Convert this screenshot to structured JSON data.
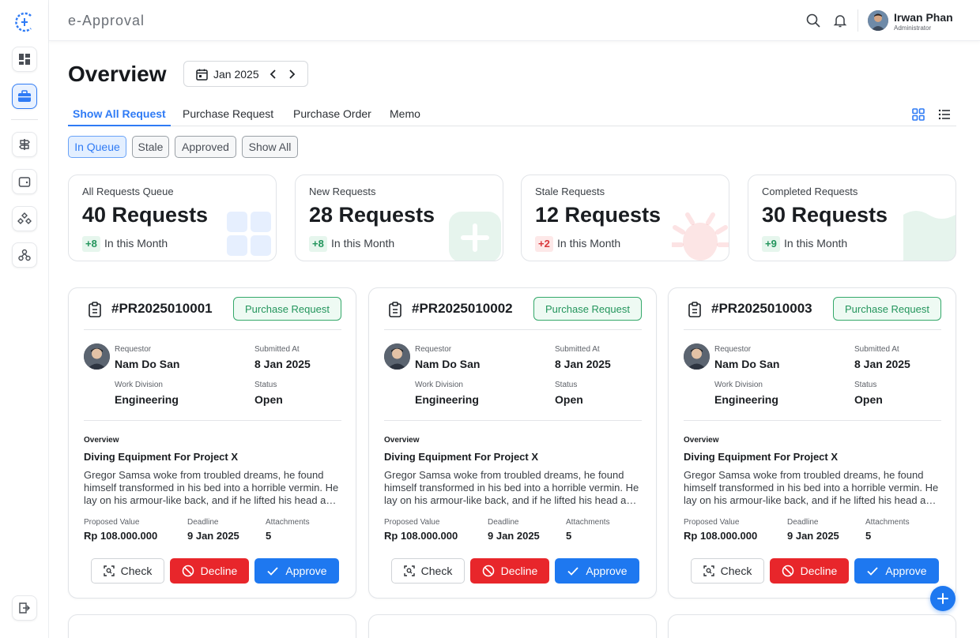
{
  "app": {
    "title": "e-Approval"
  },
  "user": {
    "name": "Irwan Phan",
    "role": "Administrator"
  },
  "header": {
    "title": "Overview",
    "date": "Jan 2025"
  },
  "tabs": [
    "Show All Request",
    "Purchase Request",
    "Purchase Order",
    "Memo"
  ],
  "filters": [
    "In Queue",
    "Stale",
    "Approved",
    "Show All"
  ],
  "stats": [
    {
      "label": "All Requests Queue",
      "value": "40 Requests",
      "delta": "+8",
      "note": "In this Month",
      "color": "#2f7bf5"
    },
    {
      "label": "New Requests",
      "value": "28 Requests",
      "delta": "+8",
      "note": "In this Month",
      "color": "#34a86a"
    },
    {
      "label": "Stale Requests",
      "value": "12 Requests",
      "delta": "+2",
      "note": "In this Month",
      "color": "#e8262b"
    },
    {
      "label": "Completed Requests",
      "value": "30 Requests",
      "delta": "+9",
      "note": "In this Month",
      "color": "#34a86a"
    }
  ],
  "labels": {
    "requestor": "Requestor",
    "submitted_at": "Submitted At",
    "work_division": "Work Division",
    "status": "Status",
    "overview": "Overview",
    "proposed_value": "Proposed Value",
    "deadline": "Deadline",
    "attachments": "Attachments",
    "check": "Check",
    "decline": "Decline",
    "approve": "Approve"
  },
  "requests": [
    {
      "id": "#PR2025010001",
      "type": "Purchase Request",
      "requestor": "Nam Do San",
      "submitted": "8 Jan 2025",
      "division": "Engineering",
      "status": "Open",
      "title": "Diving Equipment For Project X",
      "description": "Gregor Samsa woke from troubled dreams, he found himself transformed in  his bed into a horrible vermin. He lay on his armour-like back, and if he lifted his head a little he could see his brown belly.",
      "value": "Rp 108.000.000",
      "deadline": "9 Jan 2025",
      "attachments": "5"
    },
    {
      "id": "#PR2025010002",
      "type": "Purchase Request",
      "requestor": "Nam Do San",
      "submitted": "8 Jan 2025",
      "division": "Engineering",
      "status": "Open",
      "title": "Diving Equipment For Project X",
      "description": "Gregor Samsa woke from troubled dreams, he found himself transformed in  his bed into a horrible vermin. He lay on his armour-like back, and if he lifted his head a little he could see his brown belly.",
      "value": "Rp 108.000.000",
      "deadline": "9 Jan 2025",
      "attachments": "5"
    },
    {
      "id": "#PR2025010003",
      "type": "Purchase Request",
      "requestor": "Nam Do San",
      "submitted": "8 Jan 2025",
      "division": "Engineering",
      "status": "Open",
      "title": "Diving Equipment For Project X",
      "description": "Gregor Samsa woke from troubled dreams, he found himself transformed in  his bed into a horrible vermin. He lay on his armour-like back, and if he lifted his head a little he could see his brown belly.",
      "value": "Rp 108.000.000",
      "deadline": "9 Jan 2025",
      "attachments": "5"
    }
  ],
  "icons": {
    "sidebar": [
      "dashboard-icon",
      "briefcase-icon",
      "signpost-icon",
      "wallet-icon",
      "boxes-icon",
      "hierarchy-icon",
      "logout-icon"
    ],
    "top": [
      "search-icon",
      "bell-icon"
    ]
  }
}
